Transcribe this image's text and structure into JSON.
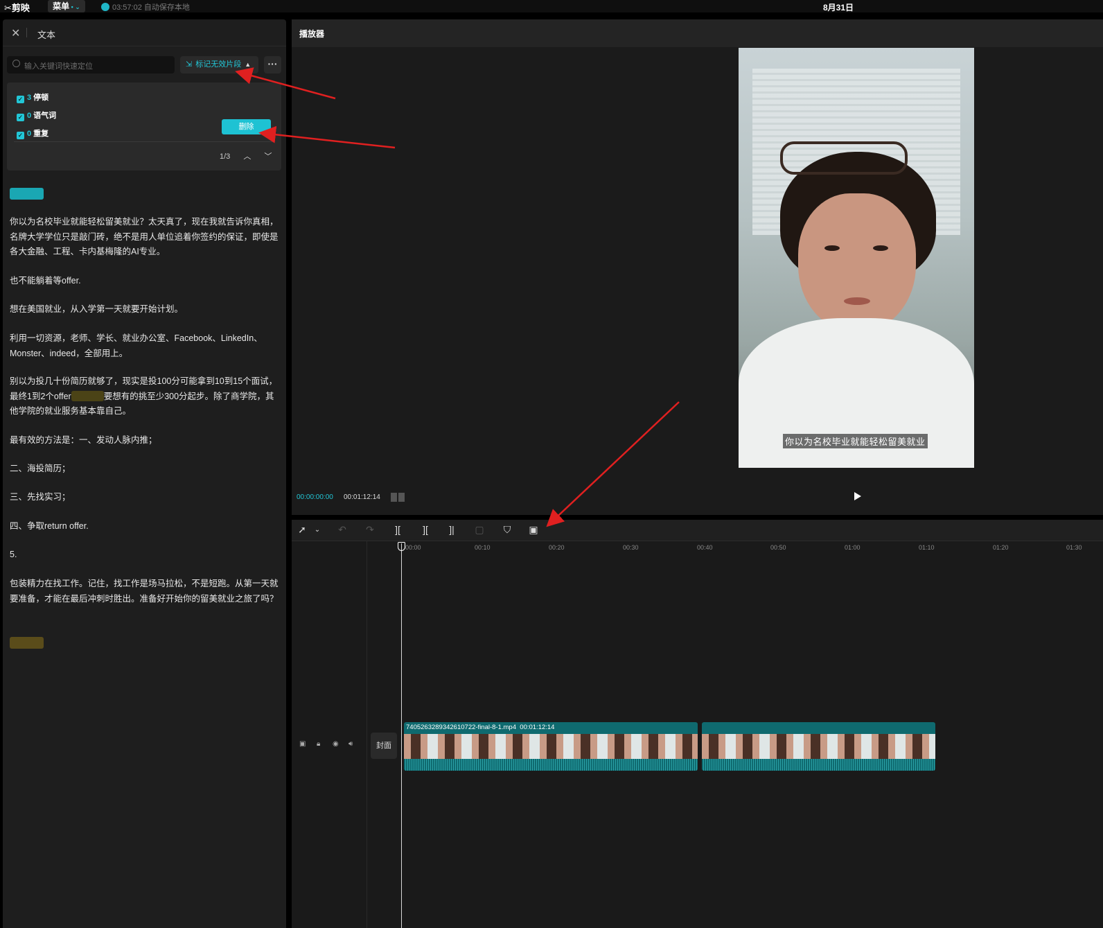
{
  "topbar": {
    "logo": "✂剪映",
    "menu_label": "菜单",
    "save_status": "03:57:02 自动保存本地",
    "date": "8月31日"
  },
  "text_panel": {
    "title": "文本",
    "search_placeholder": "输入关键词快速定位",
    "mark_button": "标记无效片段",
    "filters": [
      {
        "count": "3",
        "label": "停顿",
        "checked": true
      },
      {
        "count": "0",
        "label": "语气词",
        "checked": true
      },
      {
        "count": "0",
        "label": "重复",
        "checked": true
      }
    ],
    "delete_button": "删除",
    "pager": "1/3",
    "paragraphs": [
      "你以为名校毕业就能轻松留美就业？太天真了，现在我就告诉你真相，名牌大学学位只是敲门砖，绝不是用人单位追着你签约的保证，即使是各大金融、工程、卡内基梅隆的AI专业。",
      "也不能躺着等offer.",
      "想在美国就业，从入学第一天就要开始计划。",
      "利用一切资源，老师、学长、就业办公室、Facebook、LinkedIn、Monster、indeed，全部用上。",
      "最有效的方法是：一、发动人脉内推；",
      "二、海投简历；",
      "三、先找实习；",
      "四、争取return offer.",
      "5.",
      "包装精力在找工作。记住，找工作是场马拉松，不是短跑。从第一天就要准备，才能在最后冲刺时胜出。准备好开始你的留美就业之旅了吗？"
    ],
    "para_split": {
      "before": "别以为投几十份简历就够了，现实是投100分可能拿到10到15个面试，最终1到2个offer",
      "after": "要想有的挑至少300分起步。除了商学院，其他学院的就业服务基本靠自己。"
    }
  },
  "player": {
    "title": "播放器",
    "subtitle": "你以为名校毕业就能轻松留美就业",
    "time_current": "00:00:00:00",
    "time_total": "00:01:12:14"
  },
  "timeline": {
    "ticks": [
      "00:00",
      "00:10",
      "00:20",
      "00:30",
      "00:40",
      "00:50",
      "01:00",
      "01:10",
      "01:20",
      "01:30"
    ],
    "cover_label": "封面",
    "clip": {
      "filename": "7405263289342610722-final-8-1.mp4",
      "duration": "00:01:12:14"
    }
  },
  "colors": {
    "accent": "#22c6d6",
    "arrow": "#e02020",
    "pause_marker": "#1aa7b3",
    "filler_marker": "#5a4c1a"
  }
}
